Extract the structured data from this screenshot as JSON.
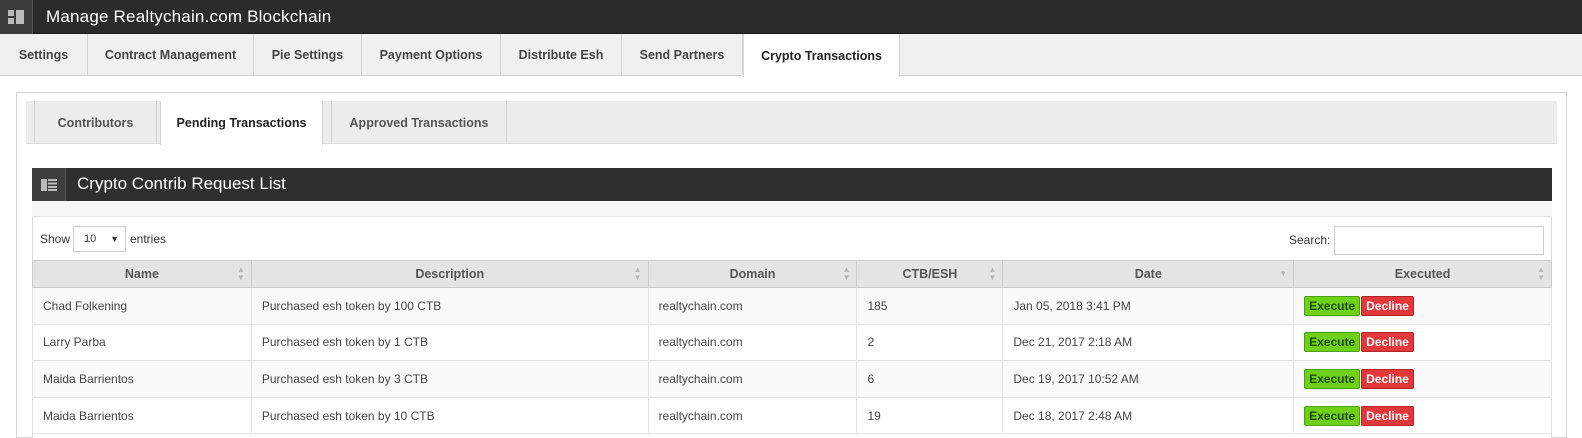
{
  "app": {
    "title": "Manage Realtychain.com Blockchain"
  },
  "main_tabs": [
    {
      "label": "Settings"
    },
    {
      "label": "Contract Management"
    },
    {
      "label": "Pie Settings"
    },
    {
      "label": "Payment Options"
    },
    {
      "label": "Distribute Esh"
    },
    {
      "label": "Send Partners"
    },
    {
      "label": "Crypto Transactions",
      "active": true
    }
  ],
  "sub_tabs": [
    {
      "label": "Contributors"
    },
    {
      "label": "Pending Transactions",
      "active": true
    },
    {
      "label": "Approved Transactions"
    }
  ],
  "list": {
    "title": "Crypto Contrib Request List",
    "show_label": "Show",
    "entries_value": "10",
    "entries_label": "entries",
    "search_label": "Search:",
    "search_value": ""
  },
  "table": {
    "columns": [
      "Name",
      "Description",
      "Domain",
      "CTB/ESH",
      "Date",
      "Executed"
    ],
    "rows": [
      {
        "name": "Chad Folkening",
        "description": "Purchased esh token by 100 CTB",
        "domain": "realtychain.com",
        "ctb_esh": "185",
        "date": "Jan 05, 2018 3:41 PM",
        "execute": "Execute",
        "decline": "Decline"
      },
      {
        "name": "Larry Parba",
        "description": "Purchased esh token by 1 CTB",
        "domain": "realtychain.com",
        "ctb_esh": "2",
        "date": "Dec 21, 2017 2:18 AM",
        "execute": "Execute",
        "decline": "Decline"
      },
      {
        "name": "Maida Barrientos",
        "description": "Purchased esh token by 3 CTB",
        "domain": "realtychain.com",
        "ctb_esh": "6",
        "date": "Dec 19, 2017 10:52 AM",
        "execute": "Execute",
        "decline": "Decline"
      },
      {
        "name": "Maida Barrientos",
        "description": "Purchased esh token by 10 CTB",
        "domain": "realtychain.com",
        "ctb_esh": "19",
        "date": "Dec 18, 2017 2:48 AM",
        "execute": "Execute",
        "decline": "Decline"
      }
    ]
  },
  "colors": {
    "execute": "#6fd01a",
    "decline": "#e0383b",
    "header_bar": "#2b2b2b"
  }
}
